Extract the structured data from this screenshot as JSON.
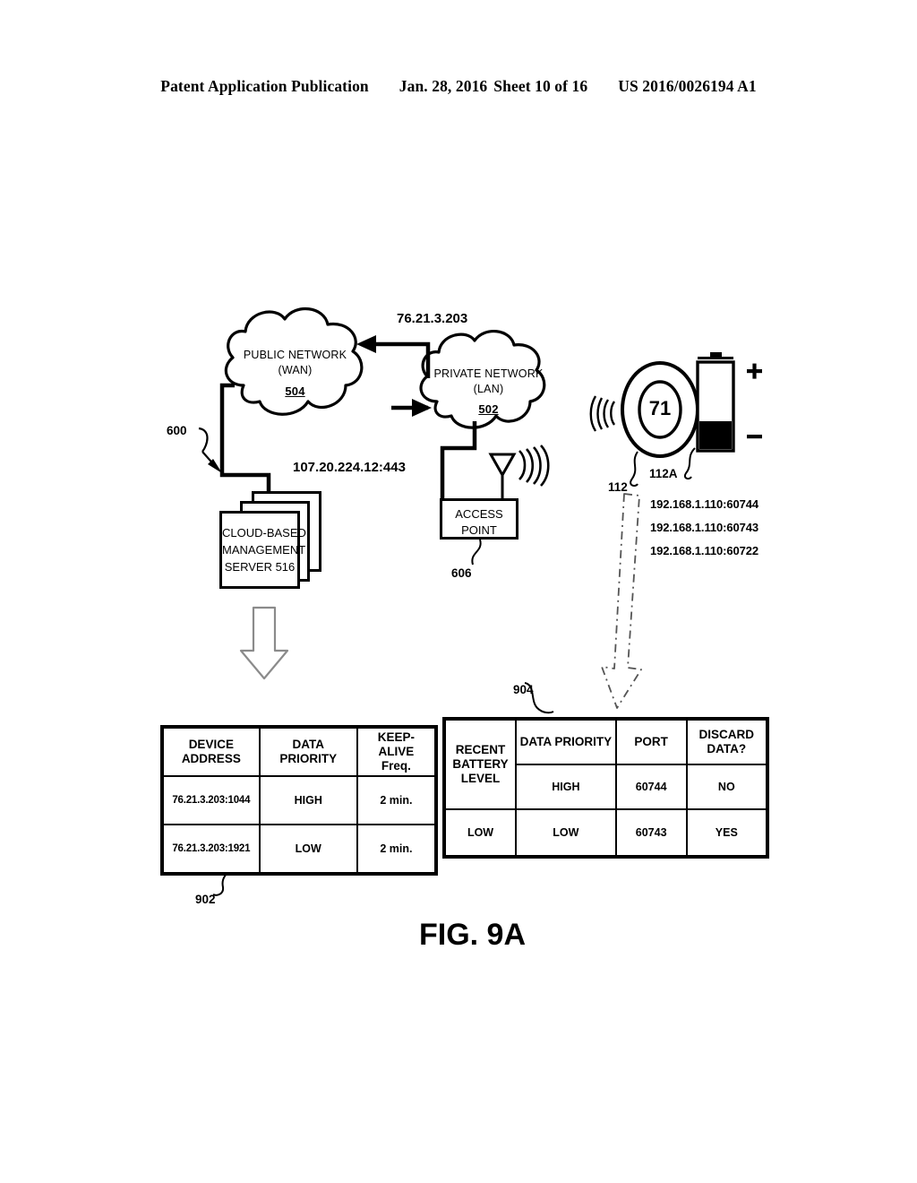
{
  "header": {
    "publication": "Patent Application Publication",
    "date": "Jan. 28, 2016",
    "sheet": "Sheet 10 of 16",
    "patent_number": "US 2016/0026194 A1"
  },
  "figure": {
    "caption": "FIG. 9A",
    "system_ref": "600"
  },
  "diagram": {
    "public_network": {
      "line1": "PUBLIC NETWORK",
      "line2": "(WAN)",
      "ref": "504"
    },
    "private_network": {
      "line1": "PRIVATE NETWORK",
      "line2": "(LAN)",
      "ref": "502"
    },
    "wan_link_address": "76.21.3.203",
    "server_link_address": "107.20.224.12:443",
    "server": {
      "line1": "CLOUD-BASED",
      "line2": "MANAGEMENT",
      "line3": "SERVER 516"
    },
    "access_point": {
      "line1": "ACCESS",
      "line2": "POINT",
      "ref": "606"
    },
    "sensor": {
      "value": "71",
      "ref": "112",
      "battery_ref": "112A",
      "battery_plus": "+",
      "battery_minus": "-"
    },
    "sensor_addresses": [
      "192.168.1.110:60744",
      "192.168.1.110:60743",
      "192.168.1.110:60722"
    ]
  },
  "table_left": {
    "ref": "902",
    "headers": [
      "DEVICE ADDRESS",
      "DATA PRIORITY",
      "KEEP-ALIVE Freq."
    ],
    "header_lines": [
      [
        "DEVICE",
        "ADDRESS"
      ],
      [
        "DATA PRIORITY"
      ],
      [
        "KEEP-ALIVE",
        "Freq."
      ]
    ],
    "rows": [
      [
        "76.21.3.203:1044",
        "HIGH",
        "2 min."
      ],
      [
        "76.21.3.203:1921",
        "LOW",
        "2 min."
      ]
    ]
  },
  "table_right": {
    "ref": "904",
    "headers": [
      "RECENT BATTERY LEVEL",
      "DATA PRIORITY",
      "PORT",
      "DISCARD DATA?"
    ],
    "header_lines": [
      [
        "RECENT",
        "BATTERY",
        "LEVEL"
      ],
      [
        "DATA PRIORITY"
      ],
      [
        "PORT"
      ],
      [
        "DISCARD",
        "DATA?"
      ]
    ],
    "rows": [
      [
        "",
        "HIGH",
        "60744",
        "NO"
      ],
      [
        "LOW",
        "LOW",
        "60743",
        "YES"
      ]
    ]
  }
}
